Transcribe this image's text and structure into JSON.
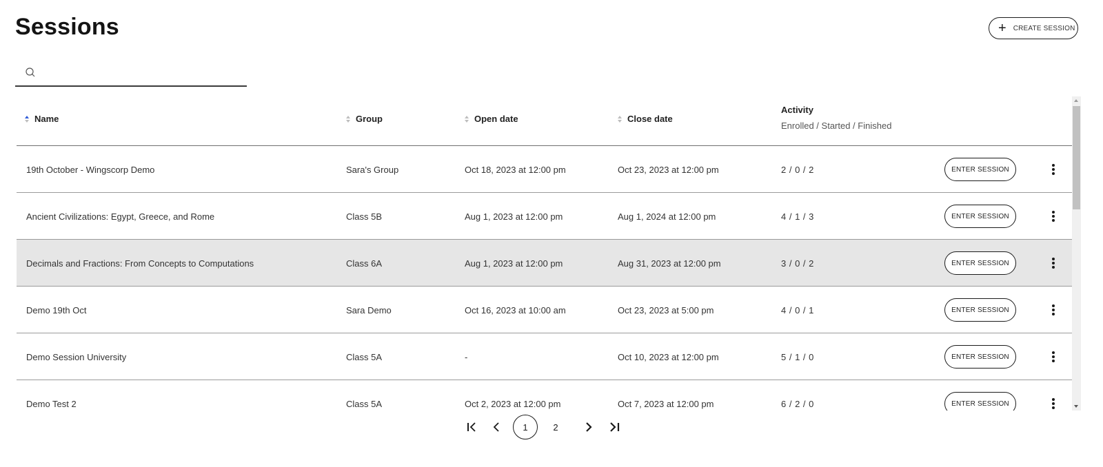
{
  "header": {
    "title": "Sessions",
    "create_button": "CREATE SESSION"
  },
  "search": {
    "placeholder": "",
    "value": ""
  },
  "table": {
    "columns": {
      "name": "Name",
      "group": "Group",
      "open_date": "Open date",
      "close_date": "Close date",
      "activity": "Activity",
      "activity_sub": "Enrolled / Started / Finished"
    },
    "sort": {
      "column": "name",
      "direction": "ascending",
      "active_color": "#2f5bd8"
    },
    "enter_label": "ENTER SESSION",
    "rows": [
      {
        "name": "19th October - Wingscorp Demo",
        "group": "Sara's Group",
        "open": "Oct 18, 2023 at 12:00 pm",
        "close": "Oct 23, 2023 at 12:00 pm",
        "activity": "2 / 0 / 2",
        "enter": "ENTER SESSION",
        "highlighted": false
      },
      {
        "name": "Ancient Civilizations: Egypt, Greece, and Rome",
        "group": "Class 5B",
        "open": "Aug 1, 2023 at 12:00 pm",
        "close": "Aug 1, 2024 at 12:00 pm",
        "activity": "4 / 1 / 3",
        "enter": "ENTER SESSION",
        "highlighted": false
      },
      {
        "name": "Decimals and Fractions: From Concepts to Computations",
        "group": "Class 6A",
        "open": "Aug 1, 2023 at 12:00 pm",
        "close": "Aug 31, 2023 at 12:00 pm",
        "activity": "3 / 0 / 2",
        "enter": "ENTER SESSION",
        "highlighted": true
      },
      {
        "name": "Demo 19th Oct",
        "group": "Sara Demo",
        "open": "Oct 16, 2023 at 10:00 am",
        "close": "Oct 23, 2023 at 5:00 pm",
        "activity": "4 / 0 / 1",
        "enter": "ENTER SESSION",
        "highlighted": false
      },
      {
        "name": "Demo Session University",
        "group": "Class 5A",
        "open": "-",
        "close": "Oct 10, 2023 at 12:00 pm",
        "activity": "5 / 1 / 0",
        "enter": "ENTER SESSION",
        "highlighted": false
      },
      {
        "name": "Demo Test 2",
        "group": "Class 5A",
        "open": "Oct 2, 2023 at 12:00 pm",
        "close": "Oct 7, 2023 at 12:00 pm",
        "activity": "6 / 2 / 0",
        "enter": "ENTER SESSION",
        "highlighted": false
      }
    ]
  },
  "pagination": {
    "current_page": "1",
    "pages": [
      "1",
      "2"
    ]
  }
}
